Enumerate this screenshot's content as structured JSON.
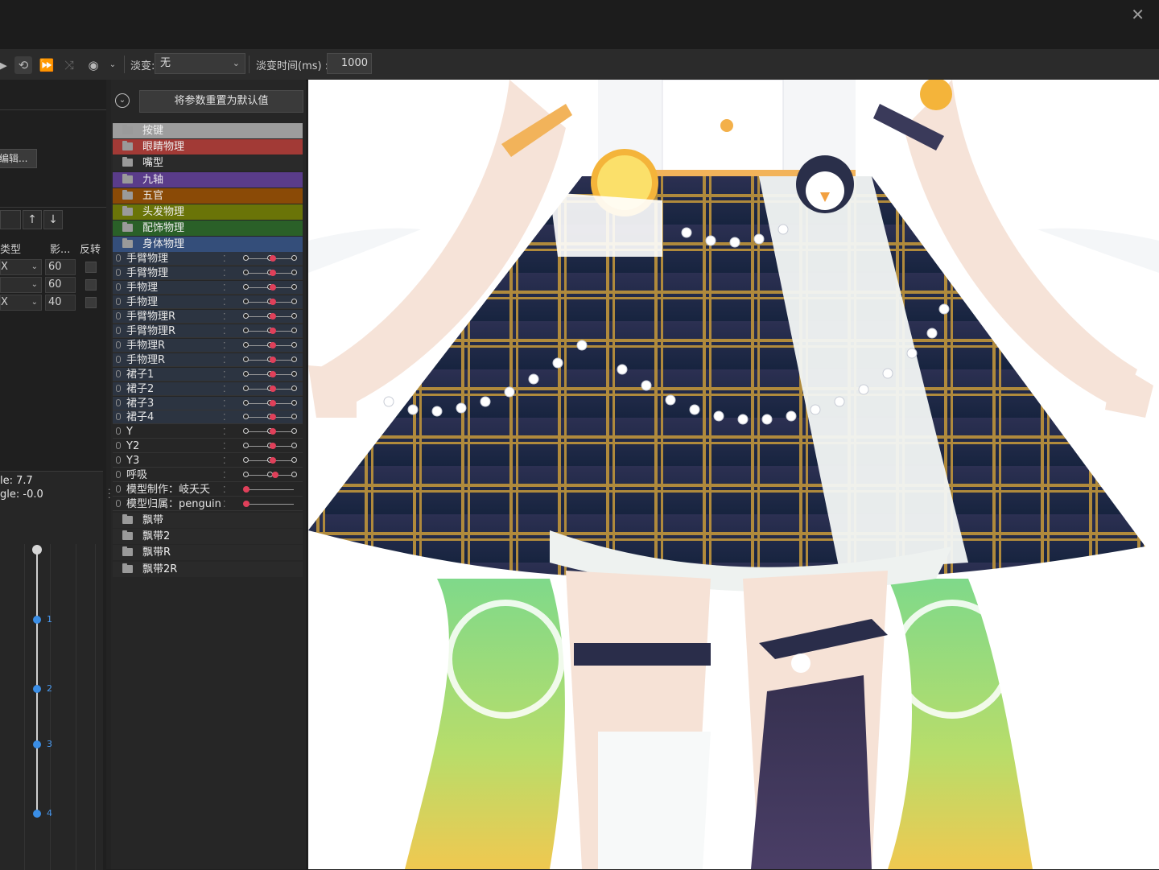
{
  "window": {
    "close_glyph": "✕"
  },
  "toolbar": {
    "fade_label": "淡变:",
    "fade_value": "无",
    "fade_time_label": "淡变时间(ms) :",
    "fade_time_value": "1000"
  },
  "left_panel": {
    "edit_button": "编辑...",
    "up_arrow": "↑",
    "down_arrow": "↓",
    "headers": {
      "type": "类型",
      "influence": "影...",
      "invert": "反转"
    },
    "rows": [
      {
        "type": "X",
        "value": "60"
      },
      {
        "type": "",
        "value": "60"
      },
      {
        "type": "X",
        "value": "40"
      }
    ],
    "graph": {
      "scale_text": "le: 7.7",
      "angle_text": "gle: -0.0",
      "keyframe_labels": [
        "1",
        "2",
        "3",
        "4"
      ]
    }
  },
  "params_panel": {
    "reset_button": "将参数重置为默认值",
    "groups_top": [
      {
        "label": "按键",
        "color": "#9d9d9d"
      },
      {
        "label": "眼睛物理",
        "color": "#a23a36"
      },
      {
        "label": "嘴型",
        "color": "#2a2a2a"
      },
      {
        "label": "九轴",
        "color": "#5a3c8a"
      },
      {
        "label": "五官",
        "color": "#8a4a06"
      },
      {
        "label": "头发物理",
        "color": "#6a7408"
      },
      {
        "label": "配饰物理",
        "color": "#2a6028"
      },
      {
        "label": "身体物理",
        "color": "#344e7a"
      }
    ],
    "params": [
      {
        "label": "手臂物理",
        "value": 0.55
      },
      {
        "label": "手臂物理",
        "value": 0.55
      },
      {
        "label": "手物理",
        "value": 0.55
      },
      {
        "label": "手物理",
        "value": 0.55
      },
      {
        "label": "手臂物理R",
        "value": 0.55
      },
      {
        "label": "手臂物理R",
        "value": 0.55
      },
      {
        "label": "手物理R",
        "value": 0.55
      },
      {
        "label": "手物理R",
        "value": 0.55
      },
      {
        "label": "裙子1",
        "value": 0.55
      },
      {
        "label": "裙子2",
        "value": 0.55
      },
      {
        "label": "裙子3",
        "value": 0.55
      },
      {
        "label": "裙子4",
        "value": 0.55
      },
      {
        "label": "Y",
        "value": 0.55
      },
      {
        "label": "Y2",
        "value": 0.55
      },
      {
        "label": "Y3",
        "value": 0.55
      },
      {
        "label": "呼吸",
        "value": 0.6
      },
      {
        "label": "模型制作：岐夭夭",
        "value": 0.0
      },
      {
        "label": "模型归属：penguin",
        "value": 0.0
      }
    ],
    "groups_bottom": [
      {
        "label": "飘带",
        "color": "#2a2a2a"
      },
      {
        "label": "飘带2",
        "color": "#2a2a2a"
      },
      {
        "label": "飘带R",
        "color": "#2a2a2a"
      },
      {
        "label": "飘带2R",
        "color": "#2a2a2a"
      }
    ]
  }
}
